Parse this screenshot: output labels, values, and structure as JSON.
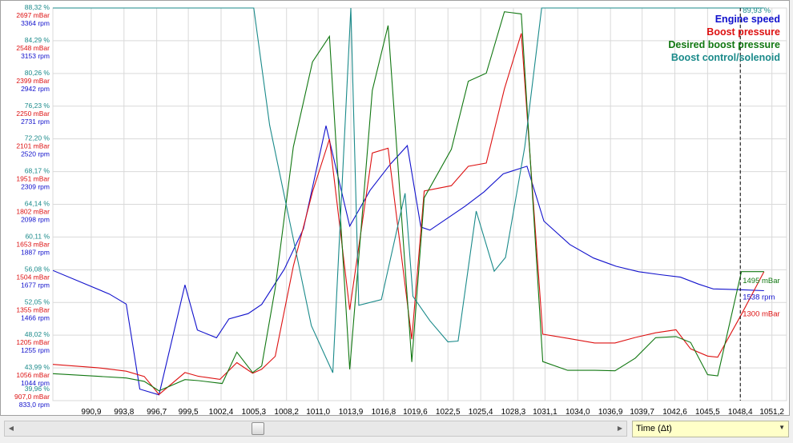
{
  "chart_data": {
    "type": "line",
    "x_label": "Time (Δt)",
    "x_ticks": [
      990.9,
      993.8,
      996.7,
      999.5,
      1002.4,
      1005.3,
      1008.2,
      1011.0,
      1013.9,
      1016.8,
      1019.6,
      1022.5,
      1025.4,
      1028.3,
      1031.1,
      1034.0,
      1036.9,
      1039.7,
      1042.6,
      1045.5,
      1048.4,
      1051.2
    ],
    "x_tick_labels": [
      "990,9",
      "993,8",
      "996,7",
      "999,5",
      "1002,4",
      "1005,3",
      "1008,2",
      "1011,0",
      "1013,9",
      "1016,8",
      "1019,6",
      "1022,5",
      "1025,4",
      "1028,3",
      "1031,1",
      "1034,0",
      "1036,9",
      "1039,7",
      "1042,6",
      "1045,5",
      "1048,4",
      "1051,2"
    ],
    "xlim": [
      987.5,
      1052.5
    ],
    "grid": true,
    "legend_position": "top-right",
    "axes": [
      {
        "id": "pct",
        "unit": "%",
        "color": "#1a8a8a",
        "ylim": [
          39.96,
          88.32
        ],
        "ticks": [
          "88,32 %",
          "84,29 %",
          "80,26 %",
          "76,23 %",
          "72,20 %",
          "68,17 %",
          "64,14 %",
          "60,11 %",
          "56,08 %",
          "52,05 %",
          "48,02 %",
          "43,99 %",
          "39,96 %"
        ]
      },
      {
        "id": "mbar",
        "unit": "mBar",
        "color": "#dd1111",
        "ylim": [
          907.0,
          2697
        ],
        "ticks": [
          "2697 mBar",
          "2548 mBar",
          "2399 mBar",
          "2250 mBar",
          "2101 mBar",
          "1951 mBar",
          "1802 mBar",
          "1653 mBar",
          "1504 mBar",
          "1355 mBar",
          "1205 mBar",
          "1056 mBar",
          "907,0 mBar"
        ]
      },
      {
        "id": "rpm",
        "unit": "rpm",
        "color": "#1111cc",
        "ylim": [
          833.0,
          3364
        ],
        "ticks": [
          "3364 rpm",
          "3153 rpm",
          "2942 rpm",
          "2731 rpm",
          "2520 rpm",
          "2309 rpm",
          "2098 rpm",
          "1887 rpm",
          "1677 rpm",
          "1466 rpm",
          "1255 rpm",
          "1044 rpm",
          "833,0 rpm"
        ]
      }
    ],
    "series": [
      {
        "name": "Engine speed",
        "axis": "rpm",
        "color": "#1111cc",
        "x": [
          987.5,
          992.5,
          994.0,
          995.2,
          996.9,
          999.2,
          1000.3,
          1002.0,
          1003.1,
          1004.8,
          1006.0,
          1008.0,
          1009.7,
          1011.7,
          1013.8,
          1015.6,
          1017.4,
          1018.9,
          1020.1,
          1020.9,
          1024.0,
          1025.7,
          1027.4,
          1029.5,
          1031.0,
          1033.3,
          1035.4,
          1037.4,
          1039.4,
          1041.3,
          1043.1,
          1044.7,
          1046.0,
          1047.0,
          1048.4,
          1050.5
        ],
        "y": [
          1672,
          1520,
          1455,
          907,
          870,
          1579,
          1288,
          1238,
          1360,
          1394,
          1453,
          1680,
          1940,
          2605,
          1958,
          2188,
          2358,
          2477,
          1952,
          1932,
          2085,
          2179,
          2295,
          2344,
          1990,
          1839,
          1752,
          1699,
          1664,
          1645,
          1629,
          1584,
          1553,
          1551,
          1548,
          1542
        ]
      },
      {
        "name": "Boost pressure",
        "axis": "mbar",
        "color": "#dd1111",
        "x": [
          987.5,
          991.5,
          994.0,
          995.6,
          996.9,
          999.2,
          1000.4,
          1002.3,
          1003.8,
          1005.2,
          1006.0,
          1007.2,
          1008.8,
          1010.5,
          1012.0,
          1013.8,
          1015.8,
          1017.2,
          1019.3,
          1020.4,
          1022.8,
          1024.3,
          1025.9,
          1027.5,
          1029.0,
          1030.9,
          1033.1,
          1035.5,
          1037.3,
          1039.1,
          1040.9,
          1042.7,
          1044.0,
          1045.5,
          1046.4,
          1048.5,
          1050.5
        ],
        "y": [
          1072,
          1057,
          1041,
          1017,
          935,
          1035,
          1018,
          1004,
          1080,
          1032,
          1050,
          1109,
          1520,
          1858,
          2099,
          1321,
          2036,
          2058,
          1187,
          1863,
          1887,
          1975,
          1990,
          2328,
          2581,
          1210,
          1191,
          1170,
          1170,
          1195,
          1216,
          1230,
          1143,
          1110,
          1105,
          1300,
          1495
        ]
      },
      {
        "name": "Desired boost pressure",
        "axis": "mbar",
        "color": "#117711",
        "x": [
          987.5,
          991.5,
          994.0,
          995.6,
          996.9,
          999.2,
          1000.4,
          1002.5,
          1003.8,
          1005.2,
          1006.0,
          1007.2,
          1008.8,
          1010.5,
          1012.0,
          1013.8,
          1015.8,
          1017.2,
          1019.3,
          1020.4,
          1022.8,
          1024.3,
          1025.9,
          1027.5,
          1029.0,
          1030.9,
          1033.1,
          1035.5,
          1037.3,
          1039.1,
          1040.9,
          1042.7,
          1044.0,
          1045.5,
          1046.4,
          1048.5,
          1050.5
        ],
        "y": [
          1030,
          1018,
          1010,
          995,
          952,
          1003,
          998,
          985,
          1128,
          1035,
          1065,
          1420,
          2063,
          2451,
          2568,
          1050,
          2321,
          2617,
          1083,
          1832,
          2053,
          2363,
          2400,
          2680,
          2670,
          1085,
          1045,
          1045,
          1043,
          1101,
          1194,
          1199,
          1172,
          1025,
          1020,
          1495,
          1495
        ]
      },
      {
        "name": "Boost control/solenoid",
        "axis": "pct",
        "color": "#1a8a8a",
        "x": [
          987.5,
          1005.3,
          1006.7,
          1008.5,
          1010.4,
          1012.3,
          1013.9,
          1014.6,
          1016.6,
          1018.7,
          1019.4,
          1020.9,
          1022.5,
          1023.4,
          1025.0,
          1026.6,
          1027.6,
          1029.3,
          1030.8,
          1031.8,
          1048.4,
          1050.5
        ],
        "y": [
          88.32,
          88.32,
          73.9,
          61.9,
          49.2,
          43.4,
          88.32,
          51.7,
          52.4,
          65.5,
          52.8,
          49.8,
          47.2,
          47.3,
          63.3,
          55.9,
          57.6,
          71.2,
          88.32,
          88.32,
          88.32,
          88.32
        ]
      }
    ],
    "end_labels": [
      {
        "text": "89,93 %",
        "series": "Boost control/solenoid"
      },
      {
        "text": "1495 mBar",
        "series": "Desired boost pressure"
      },
      {
        "text": "1538 rpm",
        "series": "Engine speed"
      },
      {
        "text": "1300 mBar",
        "series": "Boost pressure"
      }
    ],
    "cursor_x": 1048.4
  },
  "controls": {
    "x_axis_select": "Time (Δt)"
  }
}
